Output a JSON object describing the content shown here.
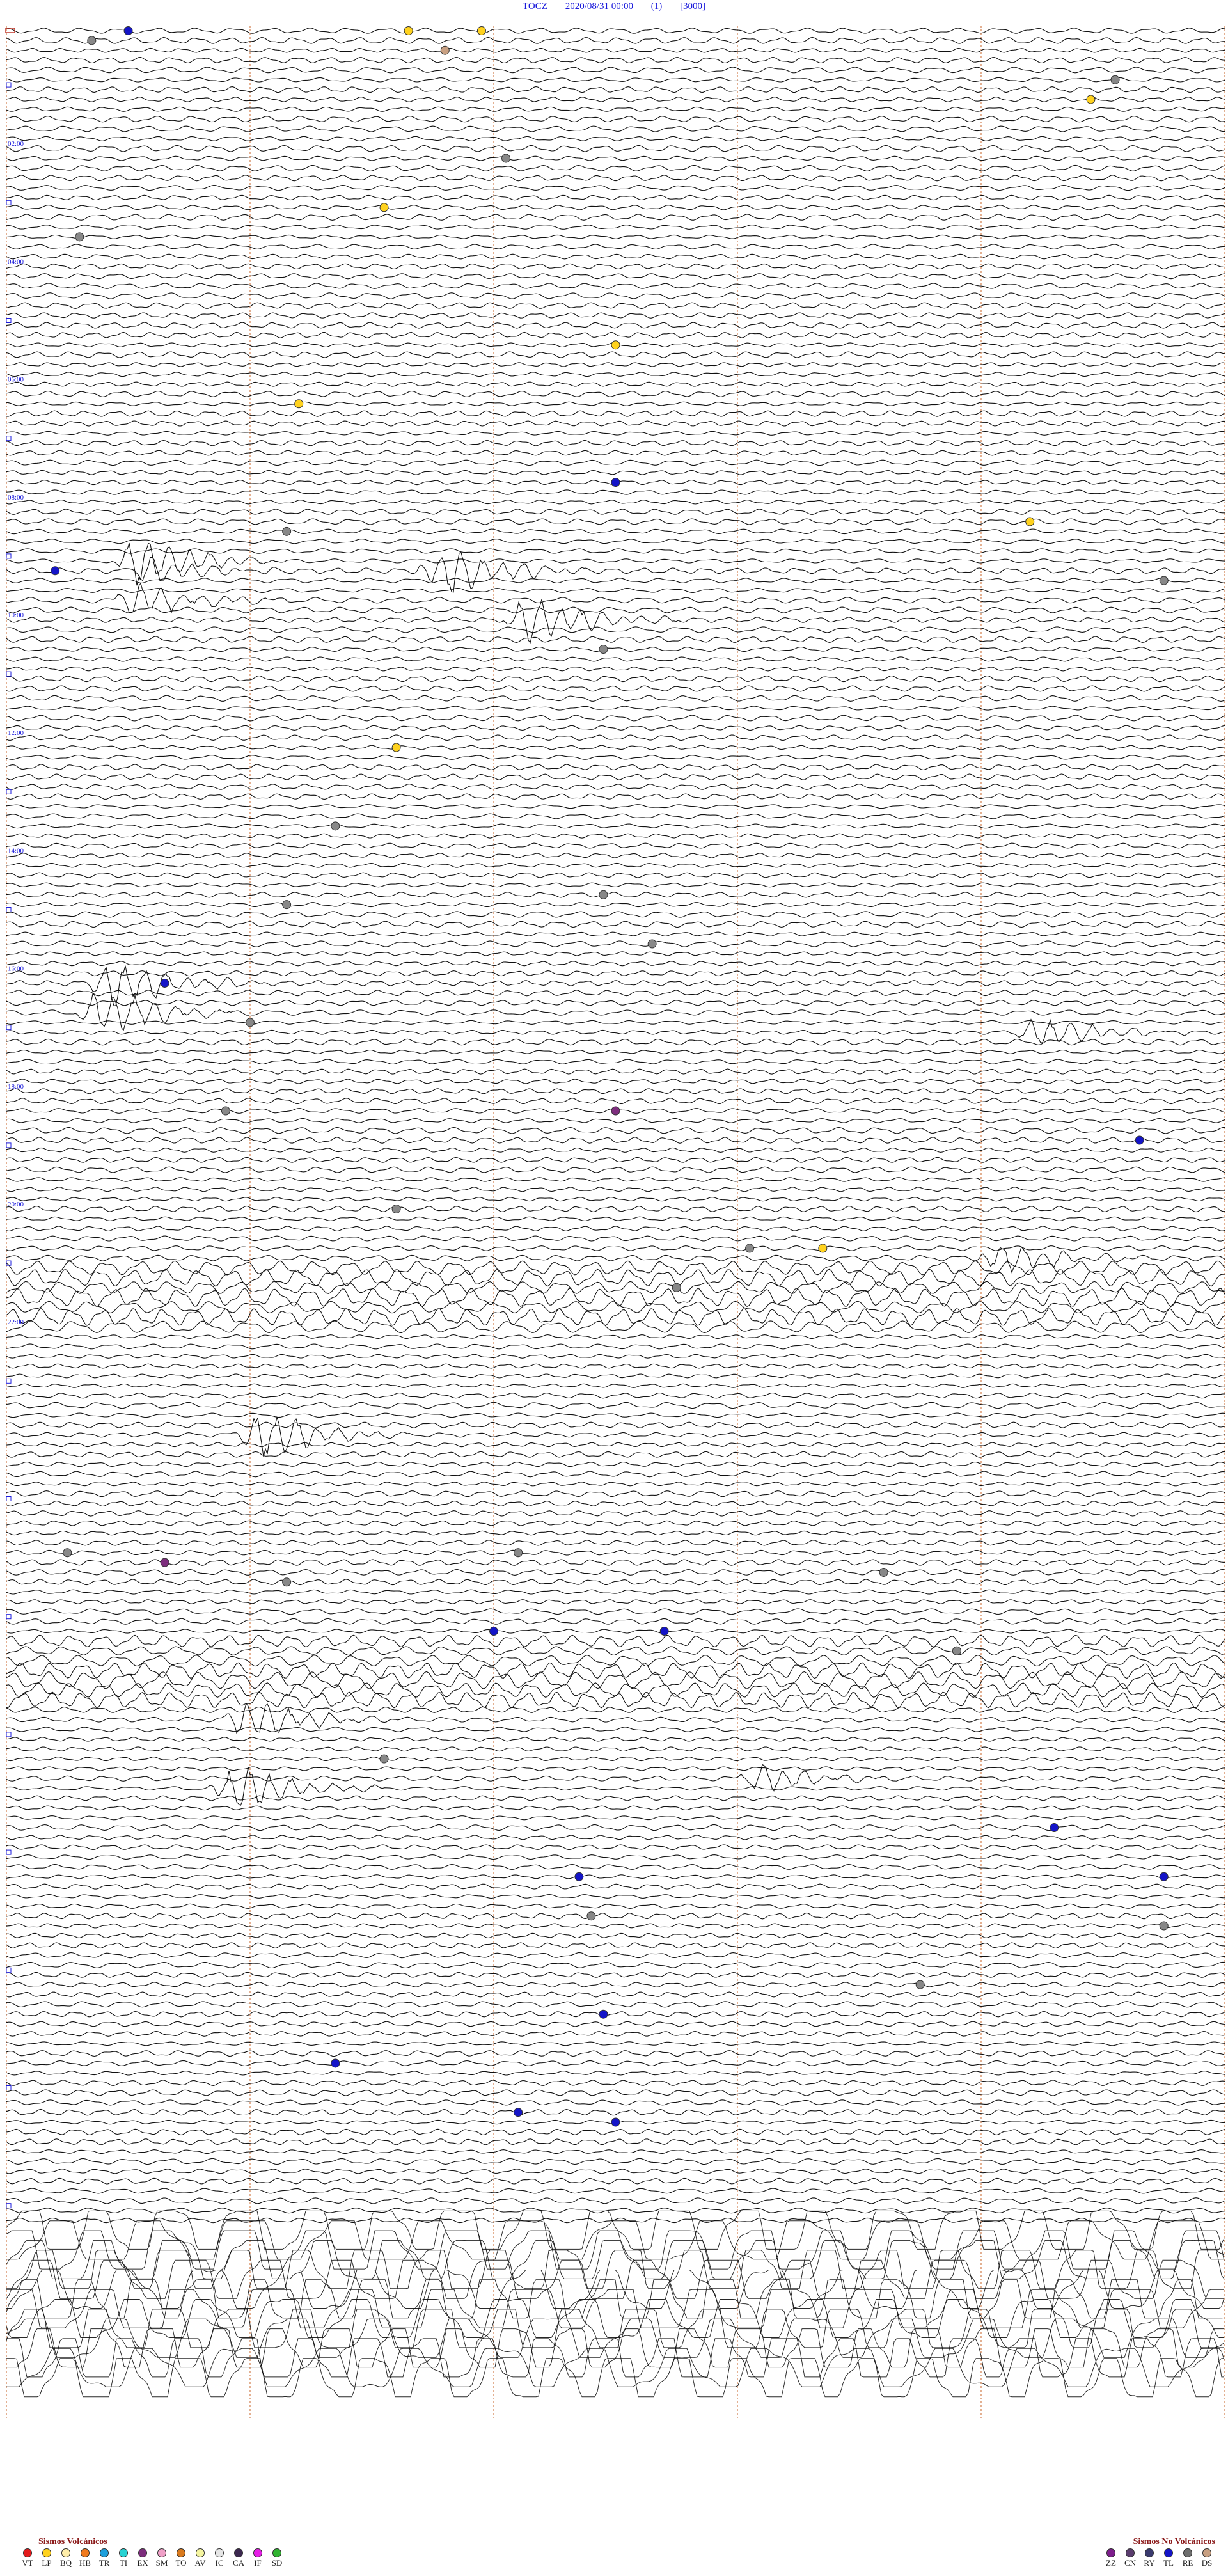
{
  "header": {
    "station": "TOCZ",
    "datetime": "2020/08/31 00:00",
    "channel": "(1)",
    "scale": "[3000]"
  },
  "chart_data": {
    "type": "seismogram",
    "trace_count": 144,
    "minutes_per_trace": 10,
    "grid": true,
    "hour_labels": [
      "02:00",
      "04:00",
      "06:00",
      "08:00",
      "10:00",
      "12:00",
      "14:00",
      "16:00",
      "18:00",
      "20:00",
      "22:00"
    ],
    "hour_label_colors": [
      "#1a1adb",
      "#1a1adb",
      "#1a1adb",
      "#1a1adb",
      "#1a1adb",
      "#1d8a1d",
      "#1a1adb",
      "#1a1adb",
      "#1a1adb",
      "#1a1adb",
      "#1a1adb"
    ],
    "trace_color": "#111111",
    "grid_color": "#c8642a",
    "event_bursts": [
      {
        "trace": 54,
        "minute": 1.1,
        "amplitude": 2.4
      },
      {
        "trace": 55,
        "minute": 3.6,
        "amplitude": 2.6
      },
      {
        "trace": 55,
        "minute": 1.2,
        "amplitude": 1.2
      },
      {
        "trace": 58,
        "minute": 1.1,
        "amplitude": 1.6
      },
      {
        "trace": 60,
        "minute": 4.3,
        "amplitude": 2.2
      },
      {
        "trace": 97,
        "minute": 0.9,
        "amplitude": 2.5
      },
      {
        "trace": 100,
        "minute": 0.8,
        "amplitude": 2.4
      },
      {
        "trace": 102,
        "minute": 8.5,
        "amplitude": 1.6
      },
      {
        "trace": 125,
        "minute": 8.2,
        "amplitude": 1.6
      },
      {
        "trace": 143,
        "minute": 2.1,
        "amplitude": 2.4
      },
      {
        "trace": 172,
        "minute": 2.0,
        "amplitude": 2.0
      },
      {
        "trace": 178,
        "minute": 6.2,
        "amplitude": 1.3
      },
      {
        "trace": 179,
        "minute": 1.9,
        "amplitude": 2.2
      }
    ],
    "event_markers": [
      {
        "trace": 0,
        "minute": 1.0,
        "class": "TL"
      },
      {
        "trace": 1,
        "minute": 0.7,
        "class": "BE"
      },
      {
        "trace": 0,
        "minute": 3.3,
        "class": "LP"
      },
      {
        "trace": 0,
        "minute": 3.9,
        "class": "LP"
      },
      {
        "trace": 2,
        "minute": 3.6,
        "class": "DS"
      },
      {
        "trace": 5,
        "minute": 9.1,
        "class": "BE"
      },
      {
        "trace": 7,
        "minute": 8.9,
        "class": "LP"
      },
      {
        "trace": 13,
        "minute": 4.1,
        "class": "BE"
      },
      {
        "trace": 18,
        "minute": 3.1,
        "class": "LP"
      },
      {
        "trace": 21,
        "minute": 0.6,
        "class": "BE"
      },
      {
        "trace": 32,
        "minute": 5.0,
        "class": "LP"
      },
      {
        "trace": 38,
        "minute": 2.4,
        "class": "LP"
      },
      {
        "trace": 46,
        "minute": 5.0,
        "class": "TL"
      },
      {
        "trace": 50,
        "minute": 8.4,
        "class": "LP"
      },
      {
        "trace": 51,
        "minute": 2.3,
        "class": "BE"
      },
      {
        "trace": 55,
        "minute": 0.4,
        "class": "TL"
      },
      {
        "trace": 56,
        "minute": 9.5,
        "class": "BE"
      },
      {
        "trace": 63,
        "minute": 4.9,
        "class": "BE"
      },
      {
        "trace": 73,
        "minute": 3.2,
        "class": "LP"
      },
      {
        "trace": 81,
        "minute": 2.7,
        "class": "BE"
      },
      {
        "trace": 88,
        "minute": 4.9,
        "class": "BE"
      },
      {
        "trace": 89,
        "minute": 2.3,
        "class": "BE"
      },
      {
        "trace": 93,
        "minute": 5.3,
        "class": "BE"
      },
      {
        "trace": 97,
        "minute": 1.3,
        "class": "TL"
      },
      {
        "trace": 101,
        "minute": 2.0,
        "class": "BE"
      },
      {
        "trace": 110,
        "minute": 1.8,
        "class": "BE"
      },
      {
        "trace": 110,
        "minute": 5.0,
        "class": "EX"
      },
      {
        "trace": 113,
        "minute": 9.3,
        "class": "TL"
      },
      {
        "trace": 120,
        "minute": 3.2,
        "class": "BE"
      },
      {
        "trace": 124,
        "minute": 6.1,
        "class": "BE"
      },
      {
        "trace": 124,
        "minute": 6.7,
        "class": "LP"
      },
      {
        "trace": 128,
        "minute": 5.5,
        "class": "BE"
      },
      {
        "trace": 155,
        "minute": 0.5,
        "class": "BE"
      },
      {
        "trace": 156,
        "minute": 1.3,
        "class": "EX"
      },
      {
        "trace": 155,
        "minute": 4.2,
        "class": "BE"
      },
      {
        "trace": 158,
        "minute": 2.3,
        "class": "BE"
      },
      {
        "trace": 157,
        "minute": 7.2,
        "class": "BE"
      },
      {
        "trace": 163,
        "minute": 4.0,
        "class": "TL"
      },
      {
        "trace": 163,
        "minute": 5.4,
        "class": "TL"
      },
      {
        "trace": 165,
        "minute": 7.8,
        "class": "BE"
      },
      {
        "trace": 176,
        "minute": 3.1,
        "class": "BE"
      },
      {
        "trace": 183,
        "minute": 8.6,
        "class": "TL"
      },
      {
        "trace": 188,
        "minute": 4.7,
        "class": "TL"
      },
      {
        "trace": 188,
        "minute": 9.5,
        "class": "TL"
      },
      {
        "trace": 192,
        "minute": 4.8,
        "class": "BE"
      },
      {
        "trace": 193,
        "minute": 9.5,
        "class": "BE"
      },
      {
        "trace": 199,
        "minute": 7.5,
        "class": "BE"
      },
      {
        "trace": 202,
        "minute": 4.9,
        "class": "TL"
      },
      {
        "trace": 207,
        "minute": 2.7,
        "class": "TL"
      },
      {
        "trace": 212,
        "minute": 4.2,
        "class": "TL"
      },
      {
        "trace": 213,
        "minute": 5.0,
        "class": "TL"
      }
    ],
    "saturated_traces_start": 224
  },
  "legend_volcanic": {
    "title": "Sismos Volcánicos",
    "items": [
      {
        "code": "VT",
        "color": "#e31a1c"
      },
      {
        "code": "LP",
        "color": "#ffd21e"
      },
      {
        "code": "BQ",
        "color": "#ffeeaa"
      },
      {
        "code": "HB",
        "color": "#f07a1e"
      },
      {
        "code": "TR",
        "color": "#1ea0dc"
      },
      {
        "code": "TI",
        "color": "#28d2d2"
      },
      {
        "code": "EX",
        "color": "#7d2d7d"
      },
      {
        "code": "SM",
        "color": "#f0a0c8"
      },
      {
        "code": "TO",
        "color": "#d97a1e"
      },
      {
        "code": "AV",
        "color": "#f5f5a0"
      },
      {
        "code": "IC",
        "color": "#e6e6e6"
      },
      {
        "code": "CA",
        "color": "#3c2850"
      },
      {
        "code": "IF",
        "color": "#e61ee6"
      },
      {
        "code": "SD",
        "color": "#32b432"
      }
    ]
  },
  "legend_nonvolcanic": {
    "title": "Sismos No Volcánicos",
    "items": [
      {
        "code": "ZZ",
        "color": "#7d1e8c"
      },
      {
        "code": "CN",
        "color": "#5a3c6e"
      },
      {
        "code": "RY",
        "color": "#3a3a6e"
      },
      {
        "code": "TL",
        "color": "#1414c8"
      },
      {
        "code": "RE",
        "color": "#6e6e6e"
      },
      {
        "code": "DS",
        "color": "#c8a082"
      }
    ]
  }
}
